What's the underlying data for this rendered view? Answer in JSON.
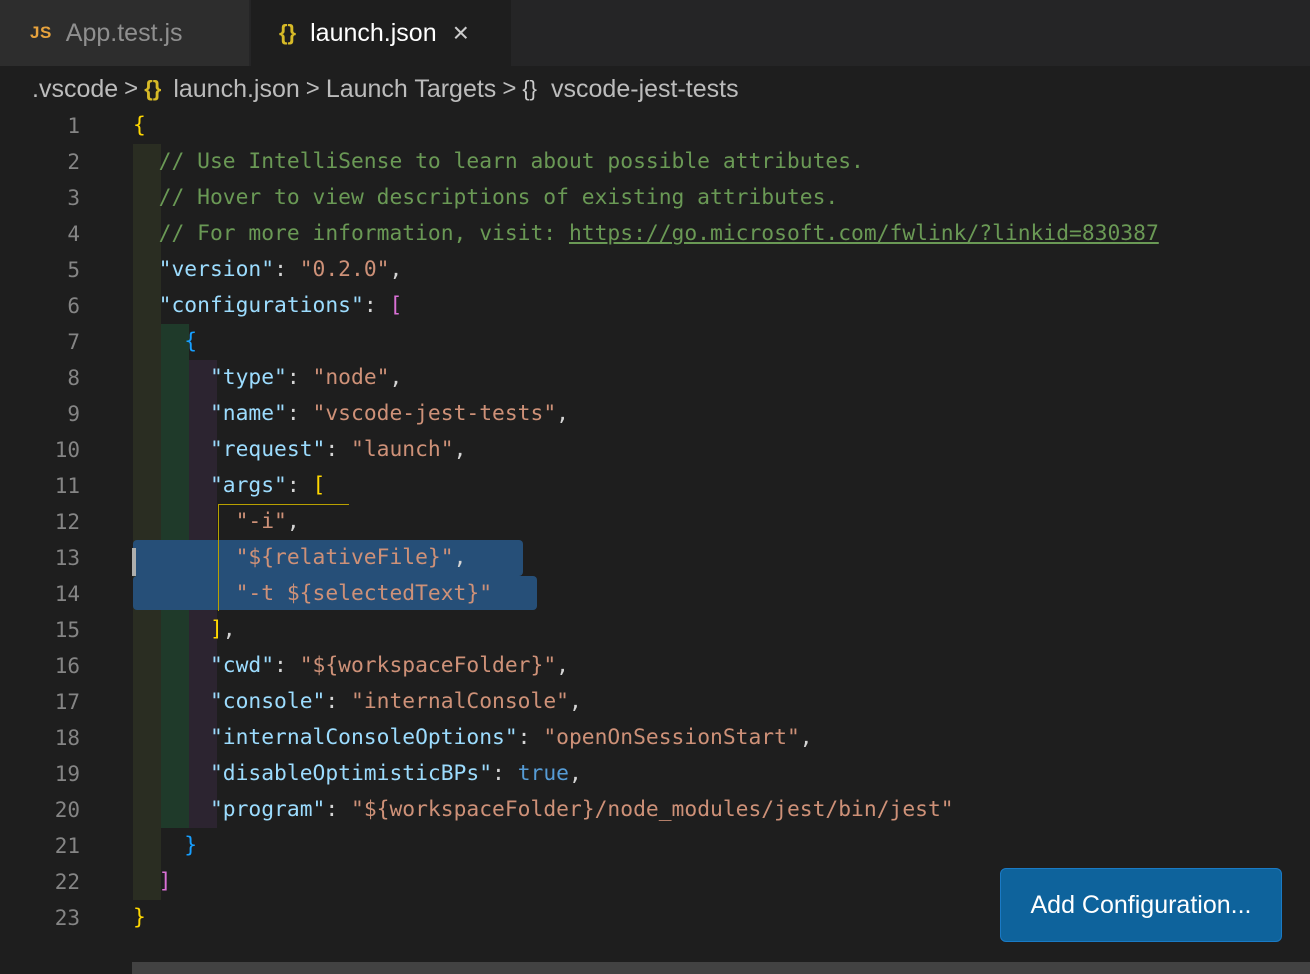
{
  "tabs": [
    {
      "icon": "JS",
      "label": "App.test.js",
      "active": false
    },
    {
      "icon": "{}",
      "label": "launch.json",
      "active": true,
      "close": "×"
    }
  ],
  "breadcrumb": {
    "folder": ".vscode",
    "file": "launch.json",
    "section": "Launch Targets",
    "item": "vscode-jest-tests",
    "separator": ">"
  },
  "editor": {
    "line_numbers": [
      "1",
      "2",
      "3",
      "4",
      "5",
      "6",
      "7",
      "8",
      "9",
      "10",
      "11",
      "12",
      "13",
      "14",
      "15",
      "16",
      "17",
      "18",
      "19",
      "20",
      "21",
      "22",
      "23"
    ],
    "lines": [
      "{",
      "// Use IntelliSense to learn about possible attributes.",
      "// Hover to view descriptions of existing attributes.",
      "// For more information, visit: https://go.microsoft.com/fwlink/?linkid=830387",
      "\"version\": \"0.2.0\",",
      "\"configurations\": [",
      "{",
      "\"type\": \"node\",",
      "\"name\": \"vscode-jest-tests\",",
      "\"request\": \"launch\",",
      "\"args\": [",
      "\"-i\",",
      "\"${relativeFile}\",",
      "\"-t ${selectedText}\"",
      "],",
      "\"cwd\": \"${workspaceFolder}\",",
      "\"console\": \"internalConsole\",",
      "\"internalConsoleOptions\": \"openOnSessionStart\",",
      "\"disableOptimisticBPs\": true,",
      "\"program\": \"${workspaceFolder}/node_modules/jest/bin/jest\"",
      "}",
      "]",
      "}"
    ],
    "tokens": {
      "comment_prefix_4": "// For more information, visit: ",
      "link": "https://go.microsoft.com/fwlink/?linkid=830387",
      "k_version": "\"version\"",
      "v_version": "\"0.2.0\"",
      "k_configurations": "\"configurations\"",
      "k_type": "\"type\"",
      "v_type": "\"node\"",
      "k_name": "\"name\"",
      "v_name": "\"vscode-jest-tests\"",
      "k_request": "\"request\"",
      "v_request": "\"launch\"",
      "k_args": "\"args\"",
      "a1": "\"-i\"",
      "a2": "\"${relativeFile}\"",
      "a3": "\"-t ${selectedText}\"",
      "k_cwd": "\"cwd\"",
      "v_cwd": "\"${workspaceFolder}\"",
      "k_console": "\"console\"",
      "v_console": "\"internalConsole\"",
      "k_ico": "\"internalConsoleOptions\"",
      "v_ico": "\"openOnSessionStart\"",
      "k_dob": "\"disableOptimisticBPs\"",
      "v_dob": "true",
      "k_program": "\"program\"",
      "v_program": "\"${workspaceFolder}/node_modules/jest/bin/jest\""
    }
  },
  "add_configuration_button": "Add Configuration...",
  "colors": {
    "background": "#1e1e1e",
    "comment": "#6a9955",
    "key": "#9cdcfe",
    "string": "#ce9178",
    "boolean": "#569cd6",
    "button": "#0e639c",
    "selection": "#264f78"
  }
}
